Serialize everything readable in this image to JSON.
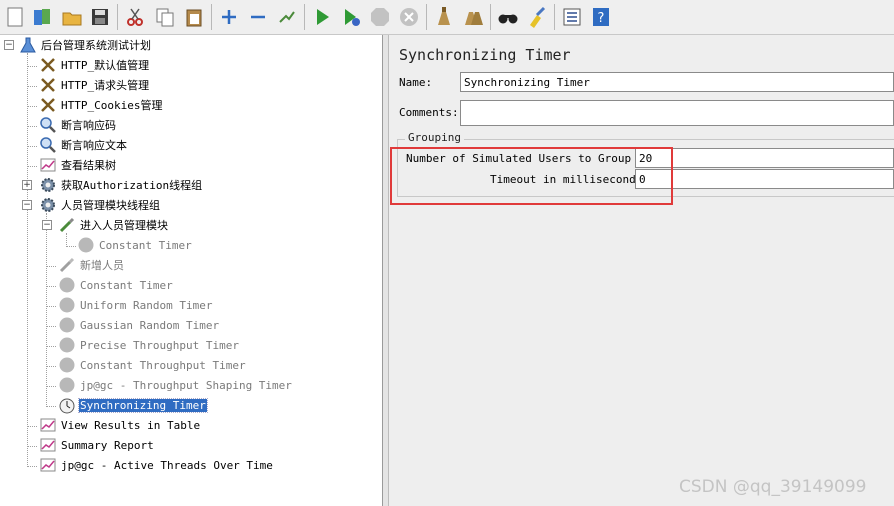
{
  "toolbar": {
    "buttons": [
      {
        "name": "new-icon"
      },
      {
        "name": "templates-icon"
      },
      {
        "name": "open-icon"
      },
      {
        "name": "save-icon"
      },
      {
        "name": "cut-icon"
      },
      {
        "name": "copy-icon"
      },
      {
        "name": "paste-icon"
      },
      {
        "name": "expand-icon"
      },
      {
        "name": "collapse-icon"
      },
      {
        "name": "toggle-icon"
      },
      {
        "name": "start-icon"
      },
      {
        "name": "start-no-pauses-icon"
      },
      {
        "name": "stop-icon"
      },
      {
        "name": "shutdown-icon"
      },
      {
        "name": "clear-icon"
      },
      {
        "name": "clear-all-icon"
      },
      {
        "name": "search-icon"
      },
      {
        "name": "reset-search-icon"
      },
      {
        "name": "function-helper-icon"
      },
      {
        "name": "help-icon"
      }
    ]
  },
  "tree": {
    "root": "后台管理系统测试计划",
    "items": [
      {
        "label": "HTTP_默认值管理"
      },
      {
        "label": "HTTP_请求头管理"
      },
      {
        "label": "HTTP_Cookies管理"
      },
      {
        "label": "断言响应码"
      },
      {
        "label": "断言响应文本"
      },
      {
        "label": "查看结果树"
      },
      {
        "label": "获取Authorization线程组"
      },
      {
        "label": "人员管理模块线程组"
      },
      {
        "label": "进入人员管理模块"
      },
      {
        "label": "Constant Timer"
      },
      {
        "label": "新增人员"
      },
      {
        "label": "Constant Timer"
      },
      {
        "label": "Uniform Random Timer"
      },
      {
        "label": "Gaussian Random Timer"
      },
      {
        "label": "Precise Throughput Timer"
      },
      {
        "label": "Constant Throughput Timer"
      },
      {
        "label": "jp@gc - Throughput Shaping Timer"
      },
      {
        "label": "Synchronizing Timer"
      },
      {
        "label": "View Results in Table"
      },
      {
        "label": "Summary Report"
      },
      {
        "label": "jp@gc - Active Threads Over Time"
      }
    ]
  },
  "panel": {
    "title": "Synchronizing Timer",
    "name_label": "Name:",
    "name_value": "Synchronizing Timer",
    "comments_label": "Comments:",
    "comments_value": "",
    "group_legend": "Grouping",
    "users_label": "Number of Simulated Users to Group by:",
    "users_value": "20",
    "timeout_label": "Timeout in milliseconds:",
    "timeout_value": "0"
  },
  "colors": {
    "highlight_box": "#e03a3a",
    "selection": "#2f6cc2"
  },
  "watermark": "CSDN @qq_39149099"
}
